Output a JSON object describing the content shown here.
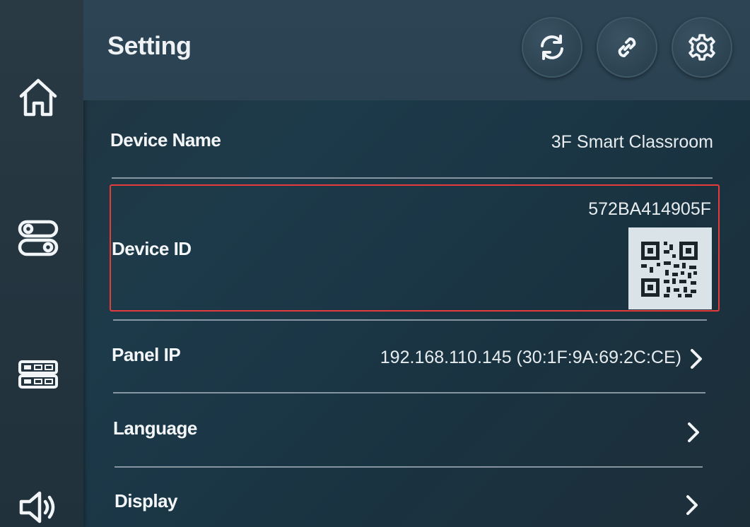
{
  "header": {
    "title": "Setting",
    "buttons": [
      {
        "name": "refresh-icon"
      },
      {
        "name": "link-icon"
      },
      {
        "name": "gear-icon"
      }
    ]
  },
  "rail": {
    "items": [
      {
        "name": "home-icon"
      },
      {
        "name": "toggle-switches-icon"
      },
      {
        "name": "device-panel-icon"
      },
      {
        "name": "speaker-icon"
      }
    ]
  },
  "settings": {
    "device_name": {
      "label": "Device Name",
      "value": "3F Smart Classroom"
    },
    "device_id": {
      "label": "Device ID",
      "value": "572BA414905F"
    },
    "panel_ip": {
      "label": "Panel IP",
      "value": "192.168.110.145 (30:1F:9A:69:2C:CE)"
    },
    "language": {
      "label": "Language"
    },
    "display": {
      "label": "Display"
    }
  },
  "colors": {
    "highlight_border": "#e53b3b",
    "background": "#1d3a4a",
    "text": "#f2f5f7"
  }
}
